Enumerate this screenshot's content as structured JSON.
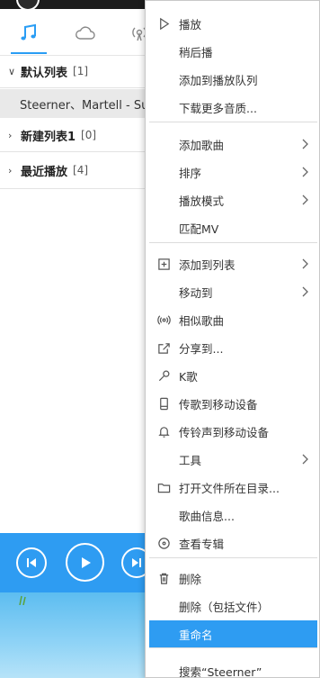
{
  "player": {
    "tabs": [
      {
        "name": "music-note-icon",
        "active": true
      },
      {
        "name": "cloud-icon",
        "active": false
      },
      {
        "name": "radio-icon",
        "active": false
      }
    ],
    "groups": [
      {
        "name": "默认列表",
        "count": "[1]",
        "expanded": true
      },
      {
        "name": "新建列表1",
        "count": "[0]",
        "expanded": false
      },
      {
        "name": "最近播放",
        "count": "[4]",
        "expanded": false
      }
    ],
    "song": "Steerner、Martell - Su",
    "accent": "#2e9cf2"
  },
  "menu": {
    "items": [
      {
        "label": "播放",
        "icon": "play-icon"
      },
      {
        "label": "稍后播"
      },
      {
        "label": "添加到播放队列"
      },
      {
        "label": "下载更多音质..."
      },
      {
        "label": "添加歌曲",
        "submenu": true
      },
      {
        "label": "排序",
        "submenu": true
      },
      {
        "label": "播放模式",
        "submenu": true
      },
      {
        "label": "匹配MV"
      },
      {
        "label": "添加到列表",
        "icon": "add-box-icon",
        "submenu": true
      },
      {
        "label": "移动到",
        "submenu": true
      },
      {
        "label": "相似歌曲",
        "icon": "radio-waves-icon"
      },
      {
        "label": "分享到...",
        "icon": "share-icon"
      },
      {
        "label": "K歌",
        "icon": "microphone-icon"
      },
      {
        "label": "传歌到移动设备",
        "icon": "phone-icon"
      },
      {
        "label": "传铃声到移动设备",
        "icon": "bell-icon"
      },
      {
        "label": "工具",
        "submenu": true
      },
      {
        "label": "打开文件所在目录...",
        "icon": "folder-icon"
      },
      {
        "label": "歌曲信息..."
      },
      {
        "label": "查看专辑",
        "icon": "album-icon"
      },
      {
        "label": "删除",
        "icon": "trash-icon"
      },
      {
        "label": "删除（包括文件）"
      },
      {
        "label": "重命名",
        "selected": true
      },
      {
        "label": "搜索“Steerner”"
      }
    ]
  }
}
